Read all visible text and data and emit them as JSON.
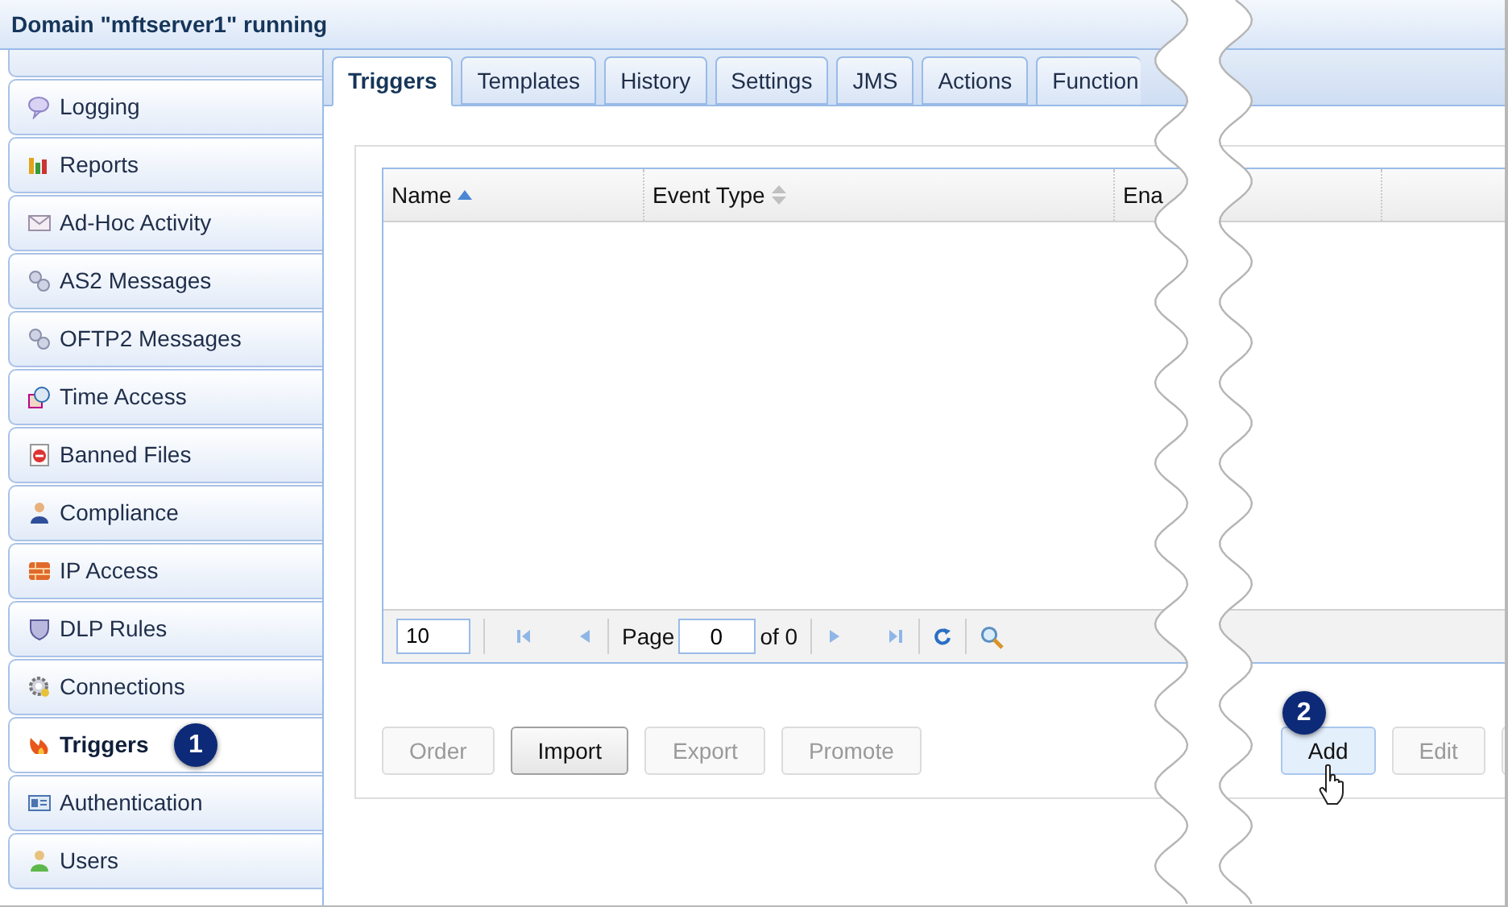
{
  "window": {
    "title": "Domain \"mftserver1\" running"
  },
  "sidebar": {
    "items": [
      {
        "label": "Logging",
        "selected": false
      },
      {
        "label": "Reports",
        "selected": false
      },
      {
        "label": "Ad-Hoc Activity",
        "selected": false
      },
      {
        "label": "AS2 Messages",
        "selected": false
      },
      {
        "label": "OFTP2 Messages",
        "selected": false
      },
      {
        "label": "Time Access",
        "selected": false
      },
      {
        "label": "Banned Files",
        "selected": false
      },
      {
        "label": "Compliance",
        "selected": false
      },
      {
        "label": "IP Access",
        "selected": false
      },
      {
        "label": "DLP Rules",
        "selected": false
      },
      {
        "label": "Connections",
        "selected": false
      },
      {
        "label": "Triggers",
        "selected": true,
        "badge": "1"
      },
      {
        "label": "Authentication",
        "selected": false
      },
      {
        "label": "Users",
        "selected": false
      }
    ]
  },
  "tabs": [
    {
      "label": "Triggers",
      "selected": true
    },
    {
      "label": "Templates",
      "selected": false
    },
    {
      "label": "History",
      "selected": false
    },
    {
      "label": "Settings",
      "selected": false
    },
    {
      "label": "JMS",
      "selected": false
    },
    {
      "label": "Actions",
      "selected": false
    },
    {
      "label": "Function",
      "selected": false
    }
  ],
  "table": {
    "columns": [
      {
        "label": "Name",
        "sorted": true
      },
      {
        "label": "Event Type",
        "sorted": false
      },
      {
        "label": "Ena"
      }
    ],
    "pager": {
      "page_size": "10",
      "page_label": "Page",
      "page": "0",
      "total": "of 0"
    }
  },
  "left_buttons": [
    {
      "label": "Order",
      "disabled": true
    },
    {
      "label": "Import",
      "disabled": false
    },
    {
      "label": "Export",
      "disabled": true
    },
    {
      "label": "Promote",
      "disabled": true
    }
  ],
  "right_buttons": [
    {
      "label": "Add",
      "disabled": false,
      "hovered": true,
      "badge": "2"
    },
    {
      "label": "Edit",
      "disabled": true,
      "hovered": false
    },
    {
      "disabled": true,
      "hovered": false
    }
  ]
}
